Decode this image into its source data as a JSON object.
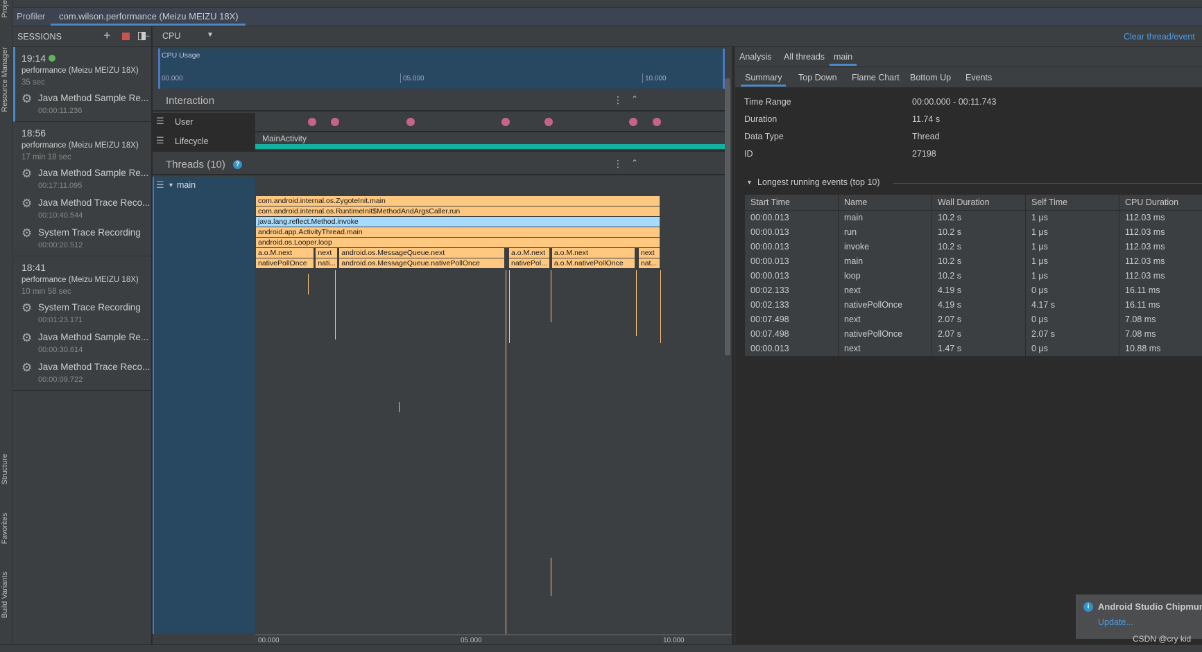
{
  "left_strip": {
    "items": [
      "Proje",
      "Resource Manager",
      "Structure",
      "Favorites",
      "Build Variants"
    ]
  },
  "tabs": {
    "profiler": "Profiler",
    "session_tab": "com.wilson.performance (Meizu MEIZU 18X)"
  },
  "sessions": {
    "title": "SESSIONS",
    "list": [
      {
        "time": "19:14",
        "live": true,
        "device": "performance (Meizu MEIZU 18X)",
        "duration": "35 sec",
        "recordings": [
          {
            "name": "Java Method Sample Re...",
            "time": "00:00:11.236"
          }
        ]
      },
      {
        "time": "18:56",
        "live": false,
        "device": "performance (Meizu MEIZU 18X)",
        "duration": "17 min 18 sec",
        "recordings": [
          {
            "name": "Java Method Sample Re...",
            "time": "00:17:11.095"
          },
          {
            "name": "Java Method Trace Reco...",
            "time": "00:10:40.544"
          },
          {
            "name": "System Trace Recording",
            "time": "00:00:20.512"
          }
        ]
      },
      {
        "time": "18:41",
        "live": false,
        "device": "performance (Meizu MEIZU 18X)",
        "duration": "10 min 58 sec",
        "recordings": [
          {
            "name": "System Trace Recording",
            "time": "00:01:23.171"
          },
          {
            "name": "Java Method Sample Re...",
            "time": "00:00:30.614"
          },
          {
            "name": "Java Method Trace Reco...",
            "time": "00:00:09.722"
          }
        ]
      }
    ]
  },
  "toolbar": {
    "profiler_select": "CPU",
    "clear_link": "Clear thread/event"
  },
  "cpu_usage": {
    "label": "CPU Usage",
    "ticks": [
      "00.000",
      "05.000",
      "10.000"
    ]
  },
  "interaction": {
    "title": "Interaction",
    "user_label": "User",
    "lifecycle_label": "Lifecycle",
    "activity": "MainActivity",
    "user_event_times_s": [
      1.38,
      1.95,
      3.81,
      6.16,
      7.22,
      9.32,
      9.89
    ]
  },
  "threads": {
    "title": "Threads (10)",
    "thread_name": "main",
    "flame": [
      [
        {
          "name": "com.android.internal.os.ZygoteInit.main",
          "start": 0,
          "end": 10.0
        }
      ],
      [
        {
          "name": "com.android.internal.os.RuntimeInit$MethodAndArgsCaller.run",
          "start": 0,
          "end": 10.0
        }
      ],
      [
        {
          "name": "java.lang.reflect.Method.invoke",
          "start": 0,
          "end": 10.0,
          "selected": true
        }
      ],
      [
        {
          "name": "android.app.ActivityThread.main",
          "start": 0,
          "end": 10.0
        }
      ],
      [
        {
          "name": "android.os.Looper.loop",
          "start": 0,
          "end": 10.0
        }
      ],
      [
        {
          "name": "a.o.M.next",
          "start": 0,
          "end": 1.46
        },
        {
          "name": "next",
          "start": 1.48,
          "end": 2.04
        },
        {
          "name": "android.os.MessageQueue.next",
          "start": 2.06,
          "end": 6.16
        },
        {
          "name": "a.o.M.next",
          "start": 6.25,
          "end": 7.28
        },
        {
          "name": "a.o.M.next",
          "start": 7.31,
          "end": 9.38
        },
        {
          "name": "next",
          "start": 9.45,
          "end": 10.0
        }
      ],
      [
        {
          "name": "nativePollOnce",
          "start": 0,
          "end": 1.46
        },
        {
          "name": "nati...",
          "start": 1.48,
          "end": 2.04
        },
        {
          "name": "android.os.MessageQueue.nativePollOnce",
          "start": 2.06,
          "end": 6.16
        },
        {
          "name": "nativePol...",
          "start": 6.25,
          "end": 7.28
        },
        {
          "name": "a.o.M.nativePollOnce",
          "start": 7.31,
          "end": 9.38
        },
        {
          "name": "nat...",
          "start": 9.45,
          "end": 10.0
        }
      ]
    ],
    "axis_ticks": [
      "00.000",
      "05.000",
      "10.000"
    ]
  },
  "analysis": {
    "tabs": [
      "Analysis",
      "All threads",
      "main"
    ],
    "active_tab": 2,
    "subtabs": [
      "Summary",
      "Top Down",
      "Flame Chart",
      "Bottom Up",
      "Events"
    ],
    "active_subtab": 0,
    "summary": [
      {
        "k": "Time Range",
        "v": "00:00.000 - 00:11.743"
      },
      {
        "k": "Duration",
        "v": "11.74 s"
      },
      {
        "k": "Data Type",
        "v": "Thread"
      },
      {
        "k": "ID",
        "v": "27198"
      }
    ],
    "longest_title": "Longest running events (top 10)",
    "columns": [
      "Start Time",
      "Name",
      "Wall Duration",
      "Self Time",
      "CPU Duration"
    ],
    "rows": [
      [
        "00:00.013",
        "main",
        "10.2 s",
        "1 μs",
        "112.03 ms"
      ],
      [
        "00:00.013",
        "run",
        "10.2 s",
        "1 μs",
        "112.03 ms"
      ],
      [
        "00:00.013",
        "invoke",
        "10.2 s",
        "1 μs",
        "112.03 ms"
      ],
      [
        "00:00.013",
        "main",
        "10.2 s",
        "1 μs",
        "112.03 ms"
      ],
      [
        "00:00.013",
        "loop",
        "10.2 s",
        "1 μs",
        "112.03 ms"
      ],
      [
        "00:02.133",
        "next",
        "4.19 s",
        "0 μs",
        "16.11 ms"
      ],
      [
        "00:02.133",
        "nativePollOnce",
        "4.19 s",
        "4.17 s",
        "16.11 ms"
      ],
      [
        "00:07.498",
        "next",
        "2.07 s",
        "0 μs",
        "7.08 ms"
      ],
      [
        "00:07.498",
        "nativePollOnce",
        "2.07 s",
        "2.07 s",
        "7.08 ms"
      ],
      [
        "00:00.013",
        "next",
        "1.47 s",
        "0 μs",
        "10.88 ms"
      ]
    ]
  },
  "notification": {
    "title": "Android Studio Chipmun",
    "link": "Update..."
  },
  "watermark": "CSDN @cry kid",
  "colors": {
    "accent": "#4a88c7",
    "flame": "#ffc880",
    "flame_selected": "#a7dcff",
    "user_event": "#c7628a",
    "lifecycle": "#14b1a0",
    "live": "#5fb65a"
  }
}
